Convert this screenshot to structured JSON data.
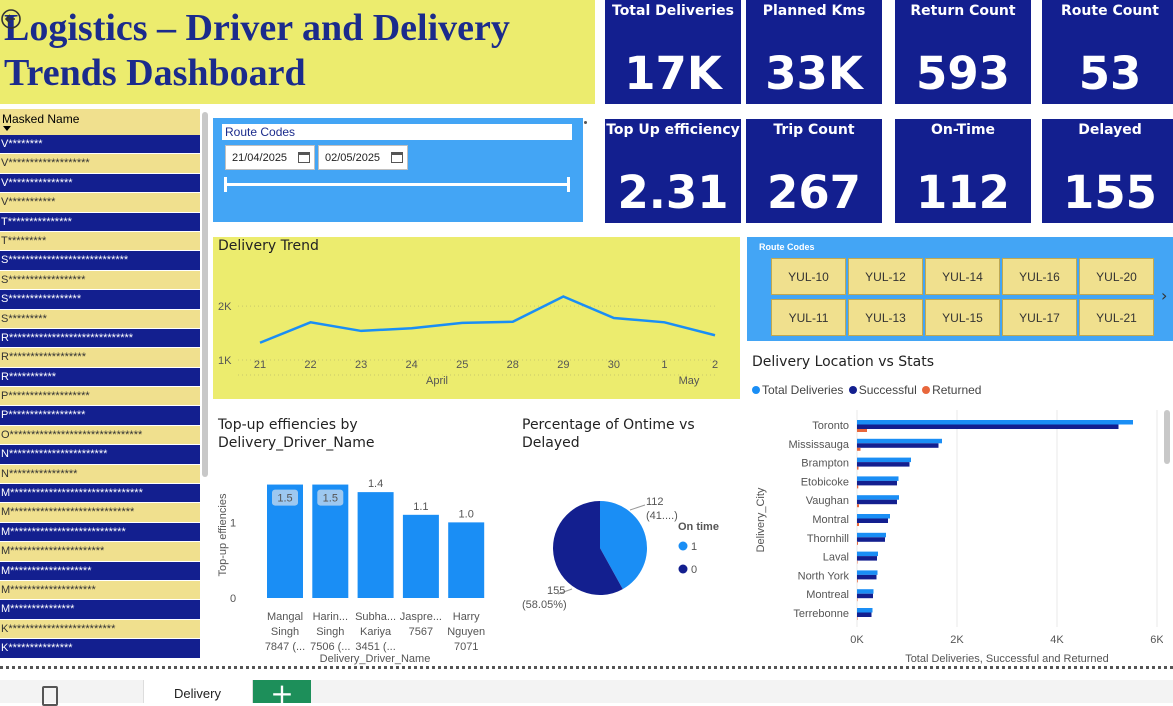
{
  "title": "Logistics – Driver and Delivery Trends Dashboard",
  "kpis": [
    {
      "label": "Total Deliveries",
      "value": "17K"
    },
    {
      "label": "Planned Kms",
      "value": "33K"
    },
    {
      "label": "Return Count",
      "value": "593"
    },
    {
      "label": "Route Count",
      "value": "53"
    },
    {
      "label": "Top Up efficiency",
      "value": "2.31"
    },
    {
      "label": "Trip Count",
      "value": "267"
    },
    {
      "label": "On-Time",
      "value": "112"
    },
    {
      "label": "Delayed",
      "value": "155"
    }
  ],
  "names_table": {
    "header": "Masked Name",
    "rows": [
      "V********",
      "V*******************",
      "V***************",
      "V***********",
      "T***************",
      "T*********",
      "S****************************",
      "S******************",
      "S*****************",
      "S*********",
      "R*****************************",
      "R******************",
      "R***********",
      "P*******************",
      "P******************",
      "O*******************************",
      "N***********************",
      "N****************",
      "M*******************************",
      "M*****************************",
      "M***************************",
      "M**********************",
      "M*******************",
      "M********************",
      "M***************",
      "K*************************",
      "K***************"
    ]
  },
  "date_filter": {
    "title": "Route Codes",
    "start": "21/04/2025",
    "end": "02/05/2025"
  },
  "route_slicer": {
    "title": "Route Codes",
    "codes": [
      "YUL-10",
      "YUL-12",
      "YUL-14",
      "YUL-16",
      "YUL-20",
      "YUL-11",
      "YUL-13",
      "YUL-15",
      "YUL-17",
      "YUL-21"
    ]
  },
  "colors": {
    "navy": "#131f8f",
    "blue": "#1a8ef5",
    "yellow": "#ecec6e",
    "orange": "#e8673c",
    "sky": "#43a5f5"
  },
  "chart_data": [
    {
      "type": "line",
      "title": "Delivery Trend",
      "x": [
        "21",
        "22",
        "23",
        "24",
        "25",
        "28",
        "29",
        "30",
        "1",
        "2"
      ],
      "x_groups": [
        "April",
        "May"
      ],
      "values": [
        1320,
        1700,
        1540,
        1590,
        1690,
        1710,
        2180,
        1780,
        1700,
        1460
      ],
      "ytick_labels": [
        "1K",
        "2K"
      ],
      "ylim": [
        1000,
        2300
      ]
    },
    {
      "type": "bar",
      "title": "Top-up effiencies by Delivery_Driver_Name",
      "xlabel": "Delivery_Driver_Name",
      "ylabel": "Top-up effiencies",
      "categories": [
        "Mangal Singh 7847 (...",
        "Harin... Singh 7506 (...",
        "Subha... Kariya 3451 (...",
        "Jaspre... 7567",
        "Harry Nguyen 7071"
      ],
      "category_lines": [
        [
          "Mangal",
          "Singh",
          "7847 (..."
        ],
        [
          "Harin...",
          "Singh",
          "7506 (..."
        ],
        [
          "Subha...",
          "Kariya",
          "3451 (..."
        ],
        [
          "Jaspre...",
          "7567"
        ],
        [
          "Harry",
          "Nguyen",
          "7071"
        ]
      ],
      "values": [
        1.5,
        1.5,
        1.4,
        1.1,
        1.0
      ],
      "data_labels": [
        "1.5",
        "1.5",
        "1.4",
        "1.1",
        "1.0"
      ],
      "ytick_labels": [
        "0",
        "1"
      ],
      "ylim": [
        0,
        1.6
      ]
    },
    {
      "type": "pie",
      "title": "Percentage of Ontime vs Delayed",
      "legend_title": "On time",
      "slices": [
        {
          "label": "1",
          "value": 112,
          "pct": 41.95,
          "text": "112",
          "pct_text": "(41....)"
        },
        {
          "label": "0",
          "value": 155,
          "pct": 58.05,
          "text": "155",
          "pct_text": "(58.05%)"
        }
      ]
    },
    {
      "type": "bar",
      "orientation": "horizontal",
      "title": "Delivery Location vs Stats",
      "xlabel": "Total Deliveries, Successful and Returned",
      "ylabel": "Delivery_City",
      "categories": [
        "Toronto",
        "Mississauga",
        "Brampton",
        "Etobicoke",
        "Vaughan",
        "Montral",
        "Thornhill",
        "Laval",
        "North York",
        "Montreal",
        "Terrebonne"
      ],
      "series": [
        {
          "name": "Total Deliveries",
          "values": [
            5520,
            1700,
            1080,
            830,
            840,
            660,
            580,
            420,
            410,
            330,
            310
          ]
        },
        {
          "name": "Successful",
          "values": [
            5230,
            1630,
            1050,
            800,
            800,
            620,
            560,
            400,
            390,
            320,
            290
          ]
        },
        {
          "name": "Returned",
          "values": [
            200,
            70,
            30,
            25,
            40,
            40,
            20,
            10,
            15,
            10,
            10
          ]
        }
      ],
      "xtick_labels": [
        "0K",
        "2K",
        "4K",
        "6K"
      ],
      "xlim": [
        0,
        6000
      ]
    }
  ],
  "bottom_bar": {
    "page_tab": "Delivery",
    "add_label": "+"
  }
}
